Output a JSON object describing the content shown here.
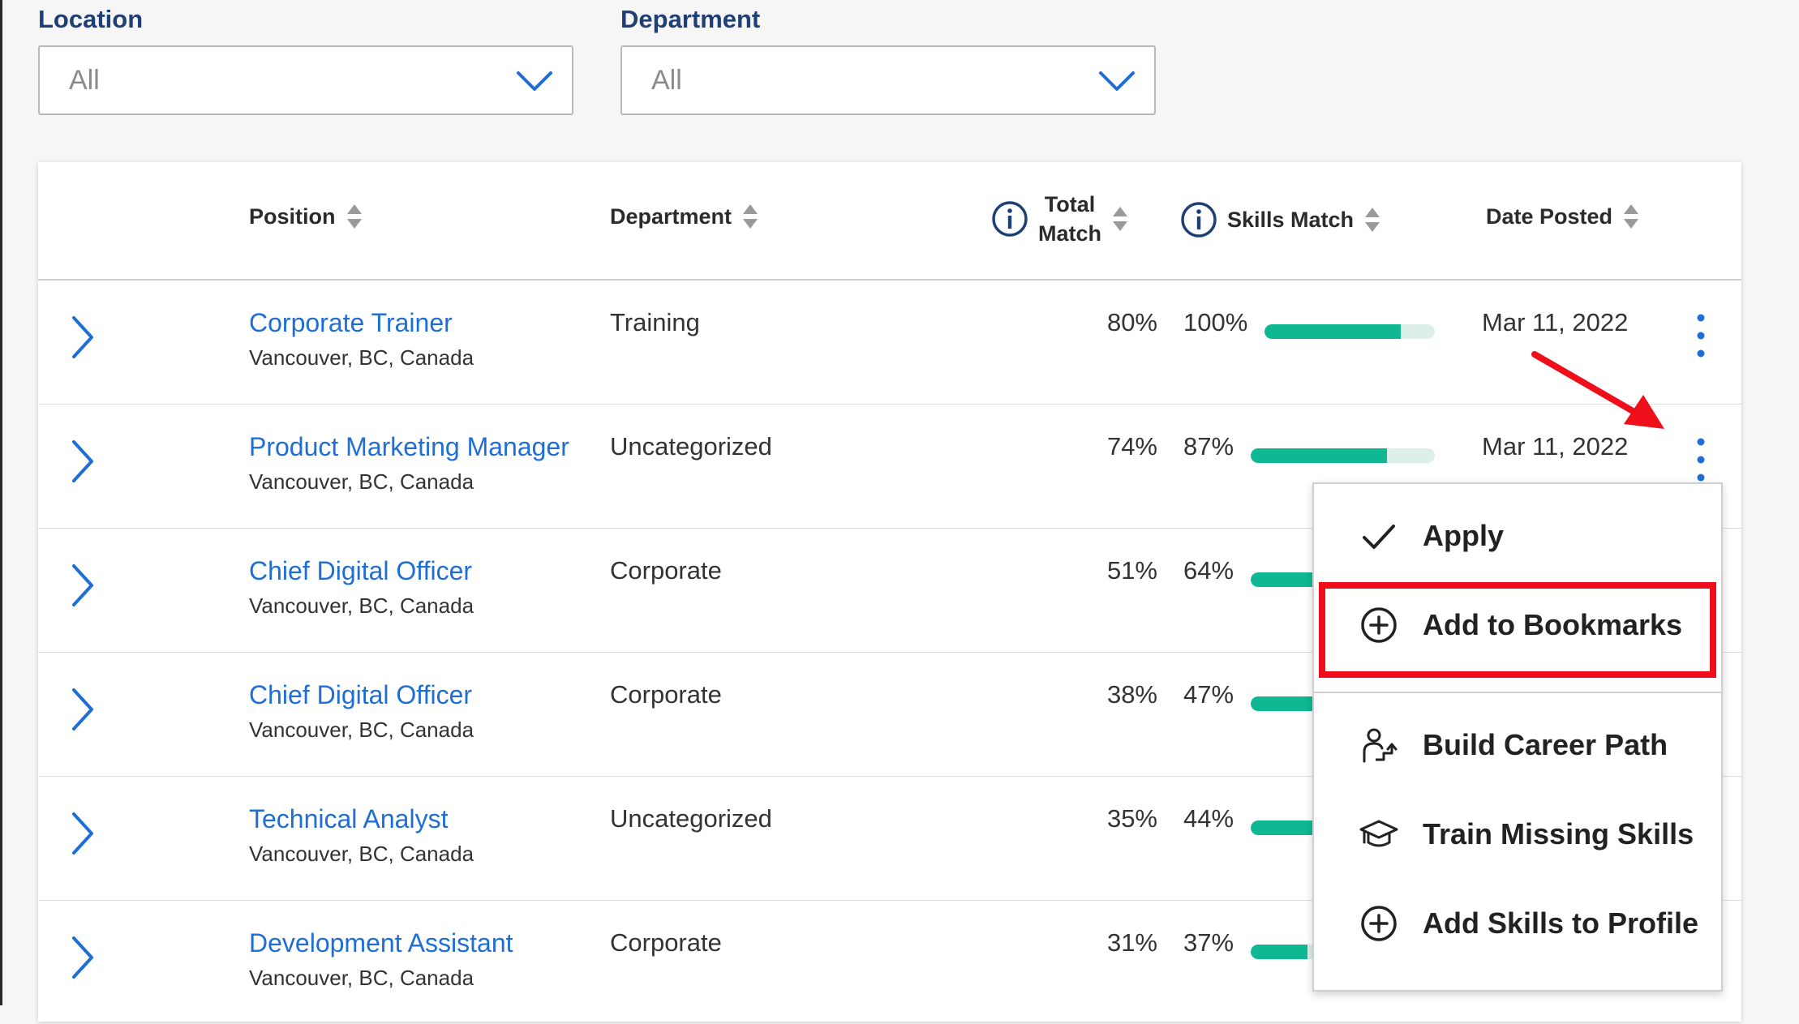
{
  "filters": {
    "location": {
      "label": "Location",
      "value": "All"
    },
    "department": {
      "label": "Department",
      "value": "All"
    }
  },
  "table": {
    "headers": {
      "position": "Position",
      "department": "Department",
      "total_match_line1": "Total",
      "total_match_line2": "Match",
      "skills_match": "Skills Match",
      "date_posted": "Date Posted"
    },
    "rows": [
      {
        "title": "Corporate Trainer",
        "location": "Vancouver, BC, Canada",
        "department": "Training",
        "total": "80%",
        "skills": "100%",
        "skills_fraction": 0.8,
        "date": "Mar 11, 2022"
      },
      {
        "title": "Product Marketing Manager",
        "location": "Vancouver, BC, Canada",
        "department": "Uncategorized",
        "total": "74%",
        "skills": "87%",
        "skills_fraction": 0.74,
        "date": "Mar 11, 2022"
      },
      {
        "title": "Chief Digital Officer",
        "location": "Vancouver, BC, Canada",
        "department": "Corporate",
        "total": "51%",
        "skills": "64%",
        "skills_fraction": 0.51,
        "date": ""
      },
      {
        "title": "Chief Digital Officer",
        "location": "Vancouver, BC, Canada",
        "department": "Corporate",
        "total": "38%",
        "skills": "47%",
        "skills_fraction": 0.38,
        "date": ""
      },
      {
        "title": "Technical Analyst",
        "location": "Vancouver, BC, Canada",
        "department": "Uncategorized",
        "total": "35%",
        "skills": "44%",
        "skills_fraction": 0.35,
        "date": ""
      },
      {
        "title": "Development Assistant",
        "location": "Vancouver, BC, Canada",
        "department": "Corporate",
        "total": "31%",
        "skills": "37%",
        "skills_fraction": 0.31,
        "date": ""
      }
    ]
  },
  "menu": {
    "items": [
      {
        "label": "Apply",
        "icon": "check-icon"
      },
      {
        "label": "Add to Bookmarks",
        "icon": "plus-circle-icon"
      },
      {
        "label": "Build Career Path",
        "icon": "career-path-icon"
      },
      {
        "label": "Train Missing Skills",
        "icon": "graduation-cap-icon"
      },
      {
        "label": "Add Skills to Profile",
        "icon": "plus-circle-icon"
      }
    ]
  },
  "colors": {
    "link": "#1f6ed6",
    "bar": "#0fb893",
    "highlight": "#ee0f1a",
    "label": "#1f3f77"
  }
}
